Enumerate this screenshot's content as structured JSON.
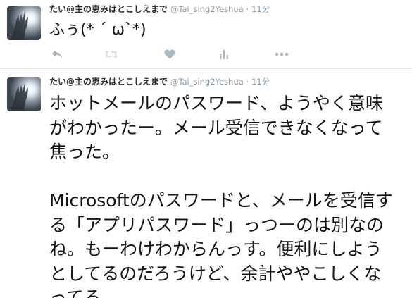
{
  "tweets": [
    {
      "display_name": "たい@主の恵みはとこしえまで",
      "handle": "@Tai_sing2Yeshua",
      "separator": "·",
      "time": "11分",
      "text": "ふぅ(* ´ ω`*)",
      "actions": [
        "reply-icon",
        "retweet-icon",
        "like-icon",
        "analytics-icon",
        "more-icon"
      ]
    },
    {
      "display_name": "たい@主の恵みはとこしえまで",
      "handle": "@Tai_sing2Yeshua",
      "separator": "·",
      "time": "11分",
      "text_lines": [
        "ホットメールのパスワード、ようやく意味",
        "がわかったー。メール受信できなくなって",
        "焦った。",
        "",
        "Microsoftのパスワードと、メールを受信す",
        "る「アプリパスワード」っつーのは別なの",
        "ね。もーわけわからんっす。便利にしよう",
        "としてるのだろうけど、余計ややこしくな",
        "ってる…"
      ]
    }
  ],
  "colors": {
    "text": "#141414",
    "meta": "#8899a6",
    "icon": "#aab8c2",
    "divider": "#e1e8ed"
  }
}
